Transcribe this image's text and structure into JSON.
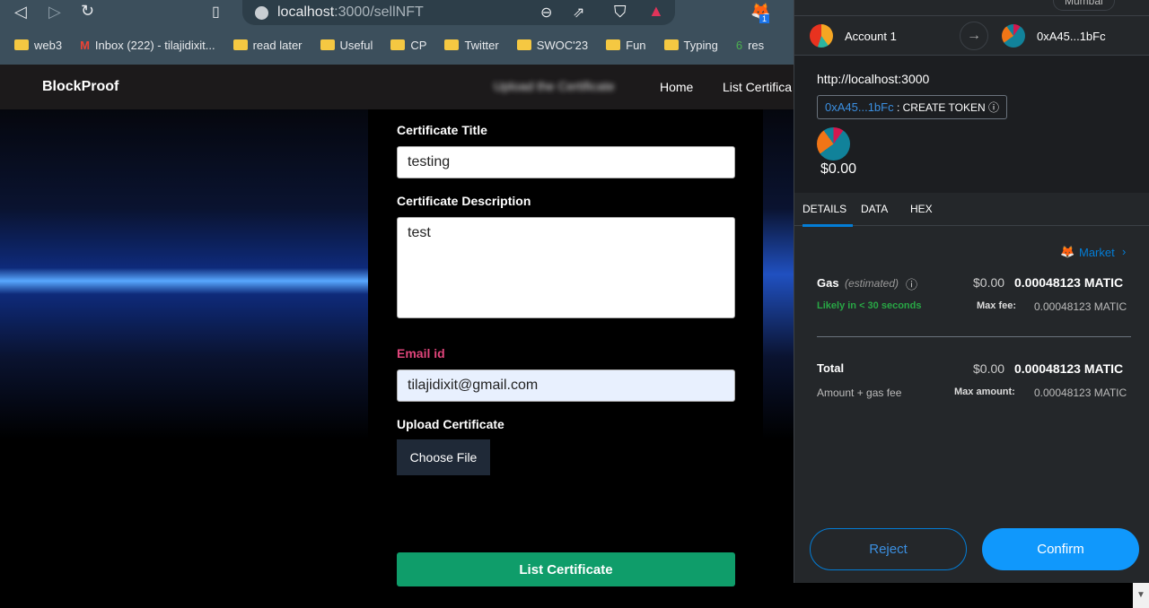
{
  "browser": {
    "url_host": "localhost",
    "url_path": ":3000/sellNFT",
    "extension_badge": "1",
    "bookmarks": [
      "web3",
      "Inbox (222) - tilajidixit...",
      "read later",
      "Useful",
      "CP",
      "Twitter",
      "SWOC'23",
      "Fun",
      "Typing",
      "res"
    ]
  },
  "site": {
    "brand": "BlockProof",
    "nav": [
      "Upload the Certificate",
      "Home",
      "List Certifica"
    ]
  },
  "form": {
    "title_label": "Certificate Title",
    "title_value": "testing",
    "desc_label": "Certificate Description",
    "desc_value": "test",
    "email_label": "Email id",
    "email_value": "tilajidixit@gmail.com",
    "upload_label": "Upload Certificate",
    "choose_file": "Choose File",
    "submit": "List Certificate"
  },
  "metamask": {
    "network": "Mumbai",
    "from_account": "Account 1",
    "to_account": "0xA45...1bFc",
    "origin": "http://localhost:3000",
    "contract": "0xA45...1bFc",
    "method": ": CREATE TOKEN",
    "value": "$0.00",
    "tabs": [
      "DETAILS",
      "DATA",
      "HEX"
    ],
    "market": "Market",
    "gas_label": "Gas",
    "gas_estimated": "(estimated)",
    "gas_usd": "$0.00",
    "gas_matic": "0.00048123 MATIC",
    "likely": "Likely in < 30 seconds",
    "max_fee_label": "Max fee:",
    "max_fee": "0.00048123 MATIC",
    "total_label": "Total",
    "total_usd": "$0.00",
    "total_matic": "0.00048123 MATIC",
    "total_sub": "Amount + gas fee",
    "max_amount_label": "Max amount:",
    "max_amount": "0.00048123 MATIC",
    "reject": "Reject",
    "confirm": "Confirm",
    "accent": "#037dd6",
    "success": "#28a745"
  }
}
